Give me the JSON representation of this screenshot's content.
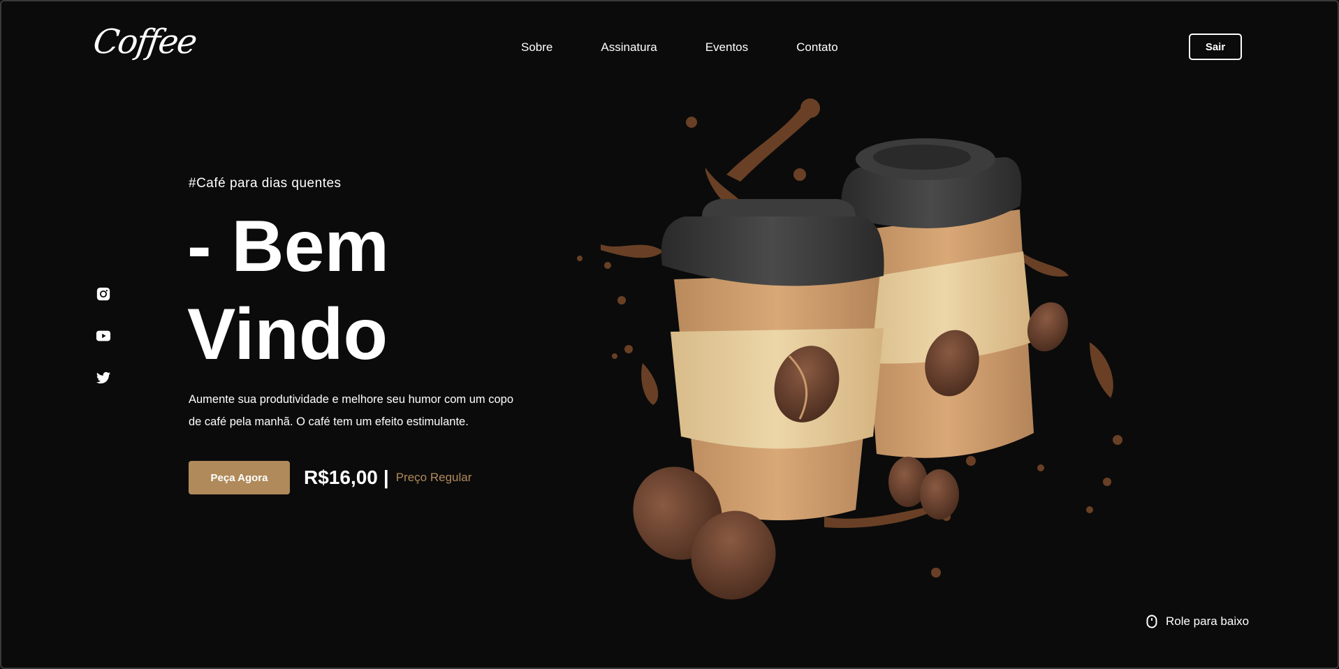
{
  "header": {
    "logo": "Coffee",
    "nav": [
      "Sobre",
      "Assinatura",
      "Eventos",
      "Contato"
    ],
    "logout_label": "Sair"
  },
  "social": {
    "icons": [
      "instagram-icon",
      "youtube-icon",
      "twitter-icon"
    ]
  },
  "hero": {
    "tag": "#Café para dias quentes",
    "headline_line1": "- Bem",
    "headline_line2": "Vindo",
    "description": "Aumente sua produtividade e melhore seu humor com um copo de café pela manhã. O café tem um efeito estimulante.",
    "order_label": "Peça Agora",
    "price": "R$16,00",
    "separator": "|",
    "regular_label": "Preço Regular"
  },
  "scroll_hint": "Role para baixo",
  "colors": {
    "background": "#0b0b0b",
    "accent": "#b08a5a",
    "text": "#ffffff",
    "cup_lid": "#3a3a3a",
    "cup_body": "#c89a6a",
    "cup_sleeve": "#e2c795",
    "bean": "#6b4330"
  }
}
